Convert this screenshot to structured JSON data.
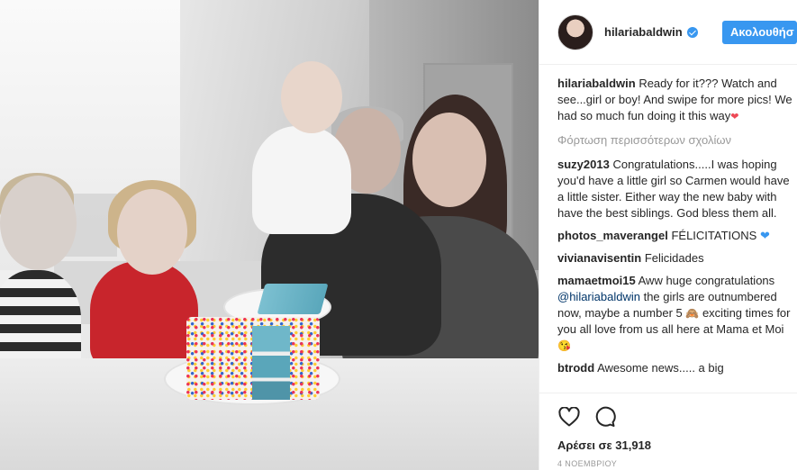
{
  "post": {
    "username": "hilariabaldwin",
    "follow_label": "Ακολουθήσ",
    "verified": true
  },
  "caption": {
    "user": "hilariabaldwin",
    "text": "Ready for it??? Watch and see...girl or boy! And swipe for more pics! We had so much fun doing it this way"
  },
  "load_more": "Φόρτωση περισσότερων σχολίων",
  "comments": [
    {
      "user": "suzy2013",
      "text": "Congratulations.....I was hoping you'd have a little girl so Carmen would have a little sister. Either way the new baby with have the best siblings. God bless them all."
    },
    {
      "user": "photos_maverangel",
      "text": "FÉLICITATIONS"
    },
    {
      "user": "vivianavisentin",
      "text": "Felicidades"
    },
    {
      "user": "mamaetmoi15",
      "text": "Aww huge congratulations",
      "mention": "@hilariabaldwin",
      "text2": "the girls are outnumbered now, maybe a number 5",
      "text3": "exciting times for you all love from us all here at Mama et Moi"
    },
    {
      "user": "btrodd",
      "text": "Awesome news..... a big"
    }
  ],
  "likes_text": "Αρέσει σε 31,918",
  "date": "4 ΝΟΕΜΒΡΙΟΥ",
  "icons": {
    "like": "heart-icon",
    "comment": "comment-icon",
    "verified": "verified-badge-icon"
  },
  "colors": {
    "accent": "#3897f0",
    "link": "#003569",
    "muted": "#999999",
    "heart": "#ed4956"
  }
}
